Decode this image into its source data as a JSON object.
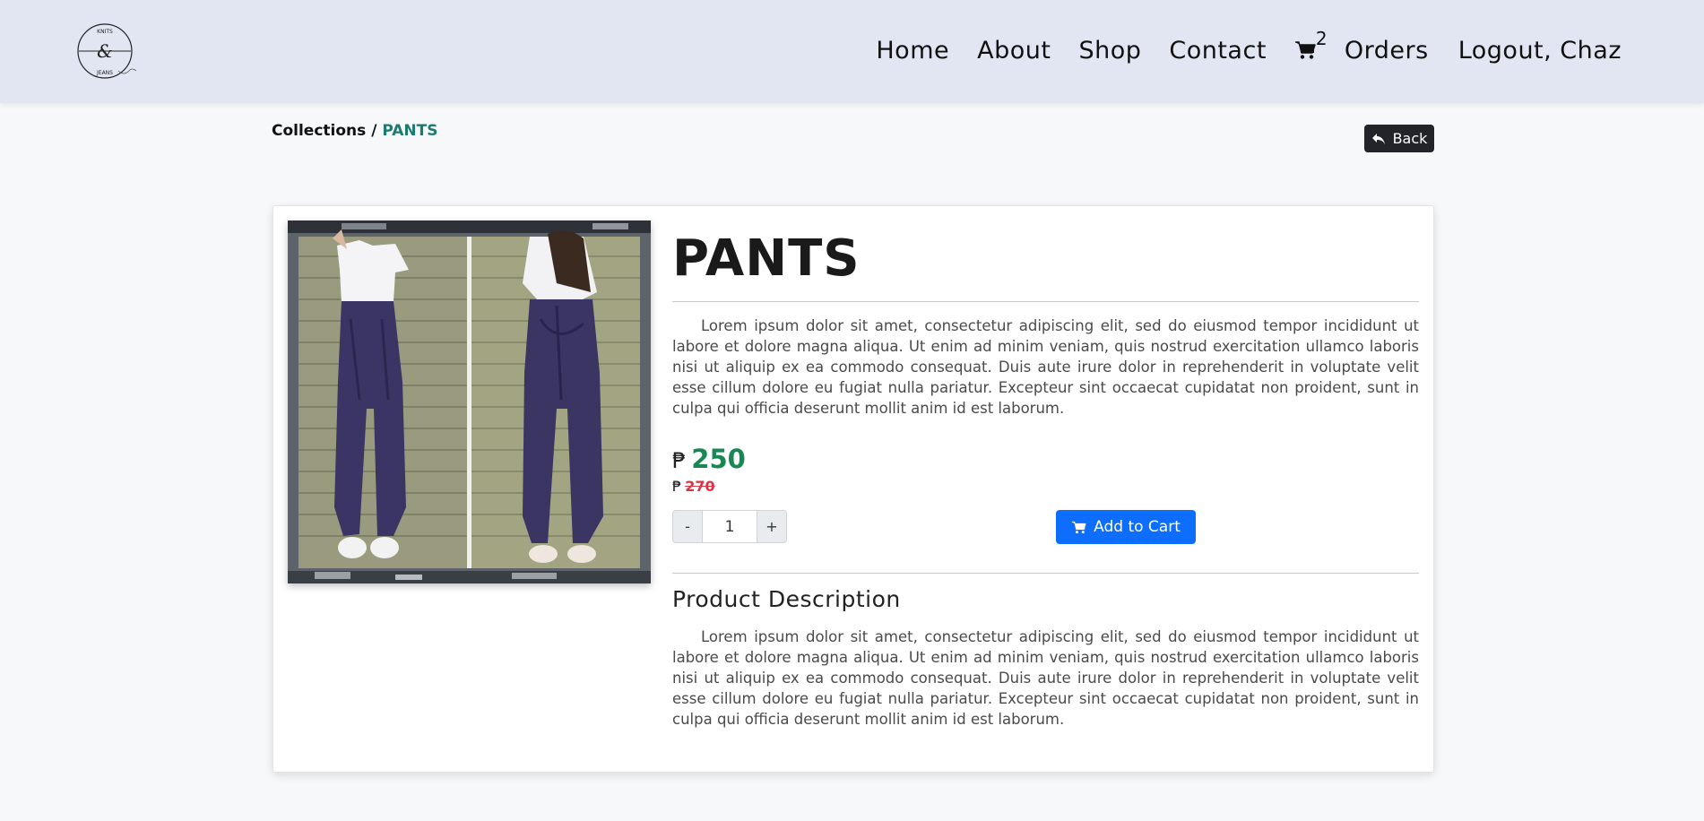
{
  "nav": {
    "logo_alt": "Knits & Jeans",
    "links": [
      "Home",
      "About",
      "Shop",
      "Contact"
    ],
    "cart_count": "2",
    "orders": "Orders",
    "logout": "Logout, Chaz"
  },
  "breadcrumb": {
    "parent": "Collections",
    "separator": " / ",
    "current": "PANTS"
  },
  "back_label": "Back",
  "product": {
    "title": "PANTS",
    "intro": "Lorem ipsum dolor sit amet, consectetur adipiscing elit, sed do eiusmod tempor incididunt ut labore et dolore magna aliqua. Ut enim ad minim veniam, quis nostrud exercitation ullamco laboris nisi ut aliquip ex ea commodo consequat. Duis aute irure dolor in reprehenderit in voluptate velit esse cillum dolore eu fugiat nulla pariatur. Excepteur sint occaecat cupidatat non proident, sunt in culpa qui officia deserunt mollit anim id est laborum.",
    "currency": "₱",
    "price": "250",
    "old_price": "270",
    "quantity": "1",
    "minus": "-",
    "plus": "+",
    "add_to_cart": "Add to Cart",
    "description_heading": "Product Description",
    "description": "Lorem ipsum dolor sit amet, consectetur adipiscing elit, sed do eiusmod tempor incididunt ut labore et dolore magna aliqua. Ut enim ad minim veniam, quis nostrud exercitation ullamco laboris nisi ut aliquip ex ea commodo consequat. Duis aute irure dolor in reprehenderit in voluptate velit esse cillum dolore eu fugiat nulla pariatur. Excepteur sint occaecat cupidatat non proident, sunt in culpa qui officia deserunt mollit anim id est laborum."
  },
  "colors": {
    "navbar": "#e1e6f2",
    "price": "#198754",
    "old_price": "#dc3545",
    "primary": "#0d6efd",
    "breadcrumb_active": "#1d7a6e"
  },
  "icons": [
    "logo-icon",
    "cart-icon",
    "back-arrow-icon",
    "add-cart-icon"
  ]
}
